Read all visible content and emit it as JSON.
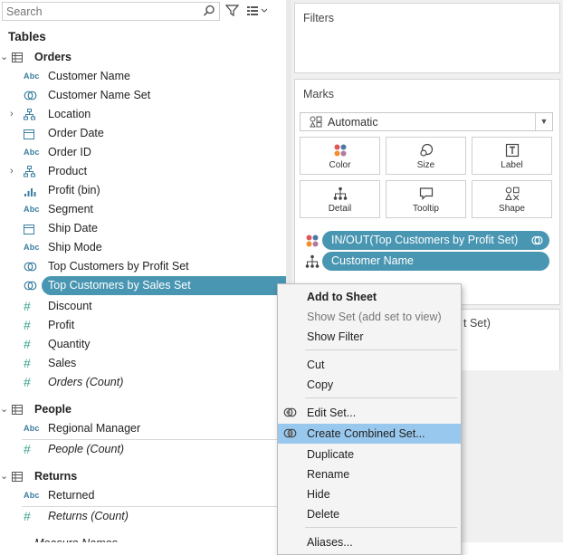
{
  "search": {
    "placeholder": "Search"
  },
  "tables_header": "Tables",
  "orders": {
    "title": "Orders",
    "fields": [
      {
        "label": "Customer Name",
        "type": "abc"
      },
      {
        "label": "Customer Name Set",
        "type": "set"
      },
      {
        "label": "Location",
        "type": "hierarchy"
      },
      {
        "label": "Order Date",
        "type": "date"
      },
      {
        "label": "Order ID",
        "type": "abc"
      },
      {
        "label": "Product",
        "type": "hierarchy"
      },
      {
        "label": "Profit (bin)",
        "type": "bin"
      },
      {
        "label": "Segment",
        "type": "abc"
      },
      {
        "label": "Ship Date",
        "type": "date"
      },
      {
        "label": "Ship Mode",
        "type": "abc"
      },
      {
        "label": "Top Customers by Profit Set",
        "type": "set"
      },
      {
        "label": "Top Customers by Sales Set",
        "type": "set"
      }
    ],
    "measures": [
      "Discount",
      "Profit",
      "Quantity",
      "Sales"
    ],
    "count": "Orders (Count)"
  },
  "people": {
    "title": "People",
    "field": "Regional Manager",
    "count": "People (Count)"
  },
  "returns": {
    "title": "Returns",
    "field": "Returned",
    "count": "Returns (Count)"
  },
  "cut_off_field": "Measure Names",
  "abc_label": "Abc",
  "filters": {
    "title": "Filters"
  },
  "marks": {
    "title": "Marks",
    "mark_type": "Automatic",
    "buttons": [
      "Color",
      "Size",
      "Label",
      "Detail",
      "Tooltip",
      "Shape"
    ],
    "pills": [
      "IN/OUT(Top Customers by Profit Set)",
      "Customer Name"
    ]
  },
  "hidden_card_partial": "t Set)",
  "menu": {
    "add_to_sheet": "Add to Sheet",
    "show_set": "Show Set (add set to view)",
    "show_filter": "Show Filter",
    "cut": "Cut",
    "copy": "Copy",
    "edit_set": "Edit Set...",
    "create_combined_set": "Create Combined Set...",
    "duplicate": "Duplicate",
    "rename": "Rename",
    "hide": "Hide",
    "delete": "Delete",
    "aliases": "Aliases..."
  },
  "colors": {
    "accent": "#4996b2",
    "highlight": "#99c8ee",
    "hash_green": "#3aa18d",
    "abc_blue": "#3b7da0"
  }
}
